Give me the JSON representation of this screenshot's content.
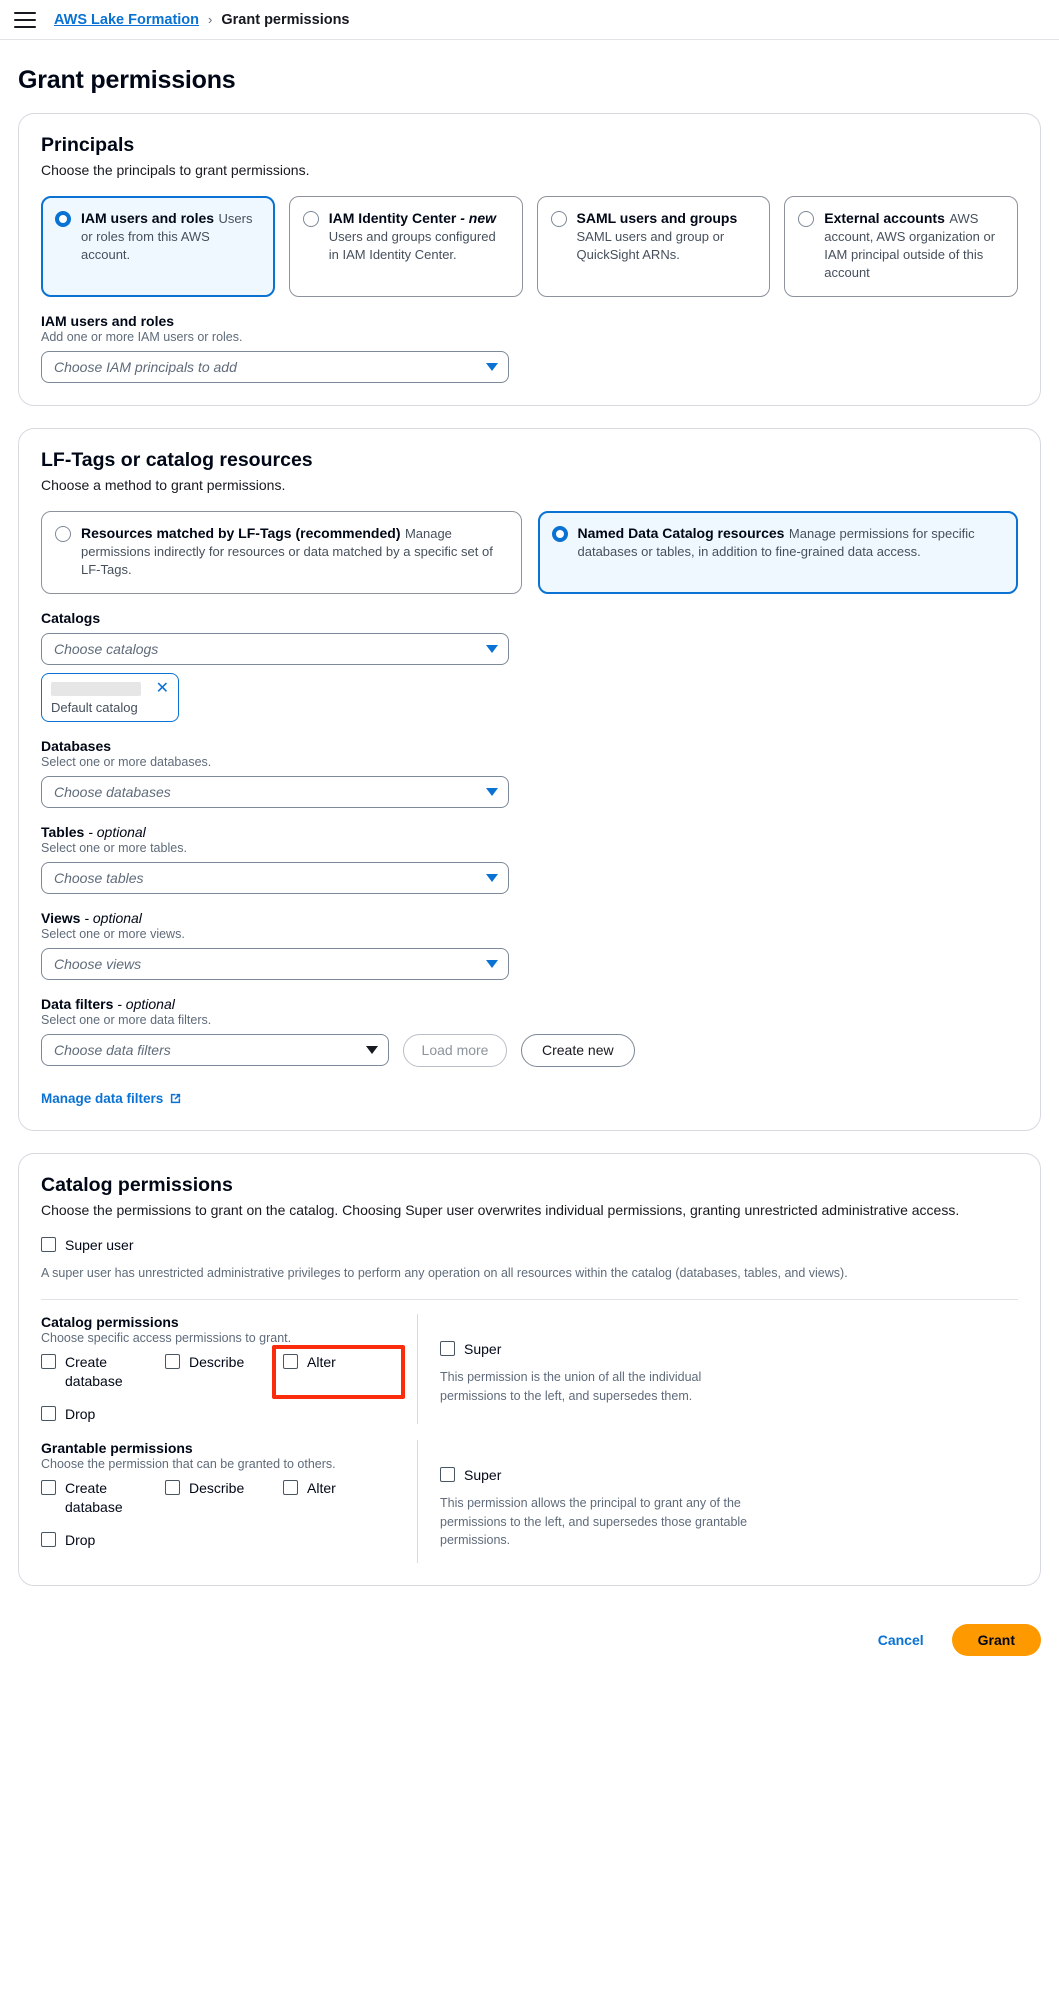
{
  "topbar": {
    "menu_icon": "hamburger-menu-icon",
    "breadcrumb_root": "AWS Lake Formation",
    "breadcrumb_separator": "›",
    "breadcrumb_current": "Grant permissions"
  },
  "page": {
    "title": "Grant permissions"
  },
  "principals": {
    "heading": "Principals",
    "description": "Choose the principals to grant permissions.",
    "options": [
      {
        "title": "IAM users and roles",
        "subtitle": "Users or roles from this AWS account.",
        "selected": true
      },
      {
        "title": "IAM Identity Center",
        "title_emphasis": "- new",
        "subtitle": "Users and groups configured in IAM Identity Center.",
        "selected": false
      },
      {
        "title": "SAML users and groups",
        "subtitle": "SAML users and group or QuickSight ARNs.",
        "selected": false
      },
      {
        "title": "External accounts",
        "subtitle": "AWS account, AWS organization or IAM principal outside of this account",
        "selected": false
      }
    ],
    "field": {
      "label": "IAM users and roles",
      "hint": "Add one or more IAM users or roles.",
      "placeholder": "Choose IAM principals to add"
    }
  },
  "resources": {
    "heading": "LF-Tags or catalog resources",
    "description": "Choose a method to grant permissions.",
    "methods": [
      {
        "title": "Resources matched by LF-Tags (recommended)",
        "subtitle": "Manage permissions indirectly for resources or data matched by a specific set of LF-Tags.",
        "selected": false
      },
      {
        "title": "Named Data Catalog resources",
        "subtitle": "Manage permissions for specific databases or tables, in addition to fine-grained data access.",
        "selected": true
      }
    ],
    "catalogs": {
      "label": "Catalogs",
      "placeholder": "Choose catalogs",
      "token_label": "Default catalog",
      "token_remove_icon": "close-icon"
    },
    "databases": {
      "label": "Databases",
      "hint": "Select one or more databases.",
      "placeholder": "Choose databases"
    },
    "tables": {
      "label": "Tables",
      "optional": "- optional",
      "hint": "Select one or more tables.",
      "placeholder": "Choose tables"
    },
    "views": {
      "label": "Views",
      "optional": "- optional",
      "hint": "Select one or more views.",
      "placeholder": "Choose views"
    },
    "data_filters": {
      "label": "Data filters",
      "optional": "- optional",
      "hint": "Select one or more data filters.",
      "placeholder": "Choose data filters",
      "load_more_label": "Load more",
      "create_new_label": "Create new"
    },
    "manage_link": "Manage data filters",
    "manage_link_icon": "external-link-icon"
  },
  "catalog_permissions": {
    "heading": "Catalog permissions",
    "description": "Choose the permissions to grant on the catalog. Choosing Super user overwrites individual permissions, granting unrestricted administrative access.",
    "super_user_label": "Super user",
    "super_user_note": "A super user has unrestricted administrative privileges to perform any operation on all resources within the catalog (databases, tables, and views).",
    "catalog": {
      "heading": "Catalog permissions",
      "subtitle": "Choose specific access permissions to grant.",
      "items": [
        "Create database",
        "Describe",
        "Alter",
        "Drop"
      ],
      "highlighted_item": "Alter",
      "highlight_color": "#fb2c0b",
      "super_label": "Super",
      "super_note": "This permission is the union of all the individual permissions to the left, and supersedes them."
    },
    "grantable": {
      "heading": "Grantable permissions",
      "subtitle": "Choose the permission that can be granted to others.",
      "items": [
        "Create database",
        "Describe",
        "Alter",
        "Drop"
      ],
      "super_label": "Super",
      "super_note": "This permission allows the principal to grant any of the permissions to the left, and supersedes those grantable permissions."
    }
  },
  "footer": {
    "cancel_label": "Cancel",
    "grant_label": "Grant",
    "grant_color": "#ff9900"
  }
}
